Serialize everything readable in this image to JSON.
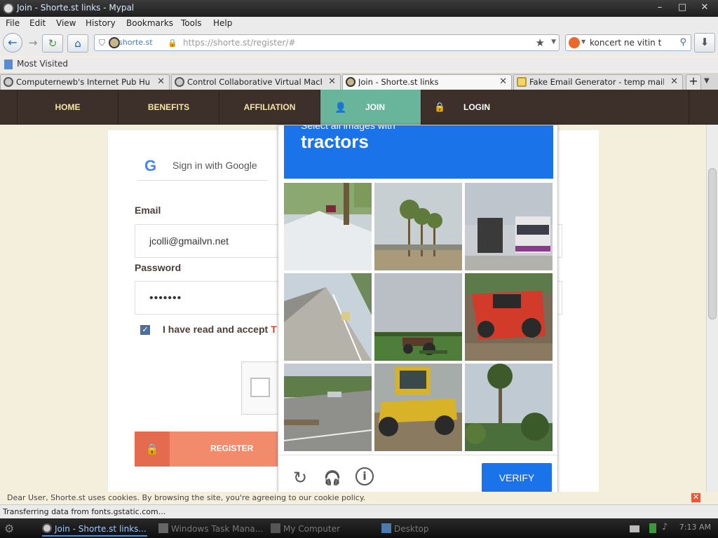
{
  "window": {
    "title": "Join - Shorte.st links - Mypal"
  },
  "menu": [
    "File",
    "Edit",
    "View",
    "History",
    "Bookmarks",
    "Tools",
    "Help"
  ],
  "navbar": {
    "site_identity": "shorte.st",
    "url": "https://shorte.st/register/#",
    "search_query": "koncert ne vitin t"
  },
  "bookmarks": {
    "most_visited": "Most Visited"
  },
  "tabs": [
    {
      "label": "Computernewb's Internet Pub Hub"
    },
    {
      "label": "Control Collaborative Virtual Mach..."
    },
    {
      "label": "Join - Shorte.st links"
    },
    {
      "label": "Fake Email Generator - temp mail a..."
    }
  ],
  "site_nav": {
    "home": "HOME",
    "benefits": "BENEFITS",
    "affiliation": "AFFILIATION",
    "join": "JOIN",
    "login": "LOGIN"
  },
  "form": {
    "google_signin": "Sign in with Google",
    "email_label": "Email",
    "email_value": "jcolli@gmailvn.net",
    "password_label": "Password",
    "password_value": "•••••••",
    "terms_text": "I have read and accept ",
    "terms_link": "T",
    "register": "REGISTER"
  },
  "captcha": {
    "instruction": "Select all images with",
    "object": "tractors",
    "verify": "VERIFY",
    "tiles": [
      "street-scene",
      "palm-trees",
      "city-bus",
      "highway",
      "tractor-in-field",
      "red-tractor",
      "road-with-car",
      "yellow-grader",
      "palm-tree"
    ]
  },
  "cookie": {
    "text": "Dear User, Shorte.st uses cookies. By browsing the site, you're agreeing to our cookie policy."
  },
  "status": {
    "text": "Transferring data from fonts.gstatic.com..."
  },
  "taskbar": {
    "items": [
      "Join - Shorte.st links...",
      "Windows Task Mana...",
      "My Computer",
      "Desktop"
    ],
    "clock": "7:13 AM"
  },
  "colors": {
    "site_header": "#3d2f2a",
    "join_tab": "#68b59b",
    "captcha_blue": "#1a73e8",
    "register_orange": "#f28a6c"
  }
}
